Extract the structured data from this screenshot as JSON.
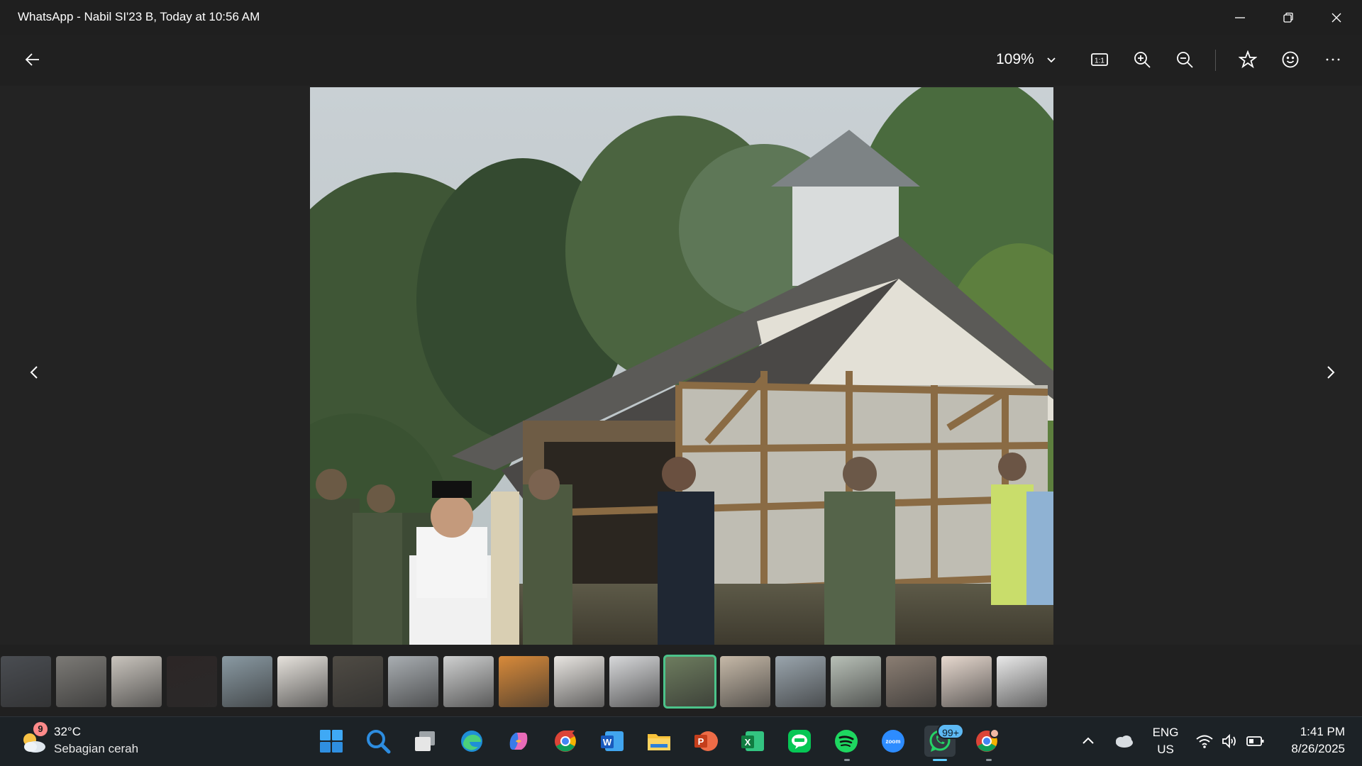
{
  "window": {
    "title": "WhatsApp - Nabil SI'23 B, Today at 10:56 AM",
    "controls": [
      "minimize-icon",
      "restore-icon",
      "close-icon"
    ]
  },
  "toolbar": {
    "zoom_value": "109%",
    "icons": [
      "back-arrow-icon",
      "chevron-down-icon",
      "actual-size-icon",
      "zoom-in-icon",
      "zoom-out-icon",
      "star-icon",
      "smiley-icon",
      "more-icon"
    ],
    "actual_size_label": "1:1"
  },
  "viewer": {
    "photo_description_icon": "photo-image",
    "nav": [
      "chevron-left-icon",
      "chevron-right-icon"
    ]
  },
  "filmstrip": {
    "count": 19,
    "selected_index": 12,
    "thumb_colors": [
      "#4a4d52",
      "#7c7a76",
      "#c9c4bd",
      "#2c2626",
      "#8a9aa3",
      "#e6e2dc",
      "#4f4b44",
      "#a9aeb2",
      "#cfd0d0",
      "#d88a3a",
      "#e8e5e1",
      "#d7d8da",
      "#6e7d5f",
      "#c6b9a8",
      "#9aa5ad",
      "#b8c0b7",
      "#8b7e73",
      "#e7d9cf",
      "#e9e9e9"
    ]
  },
  "taskbar": {
    "weather": {
      "temp": "32°C",
      "desc": "Sebagian cerah",
      "badge": "9"
    },
    "apps": [
      "windows-start-icon",
      "search-icon",
      "task-view-icon",
      "edge-icon",
      "copilot-icon",
      "chrome-icon",
      "word-icon",
      "file-explorer-icon",
      "powerpoint-icon",
      "excel-icon",
      "line-icon",
      "spotify-icon",
      "zoom-icon",
      "whatsapp-icon",
      "chrome-profile-icon"
    ],
    "zoom_label": "zoom",
    "whatsapp_badge": "99+",
    "tray": {
      "lang_top": "ENG",
      "lang_bottom": "US",
      "time": "1:41 PM",
      "date": "8/26/2025"
    }
  }
}
